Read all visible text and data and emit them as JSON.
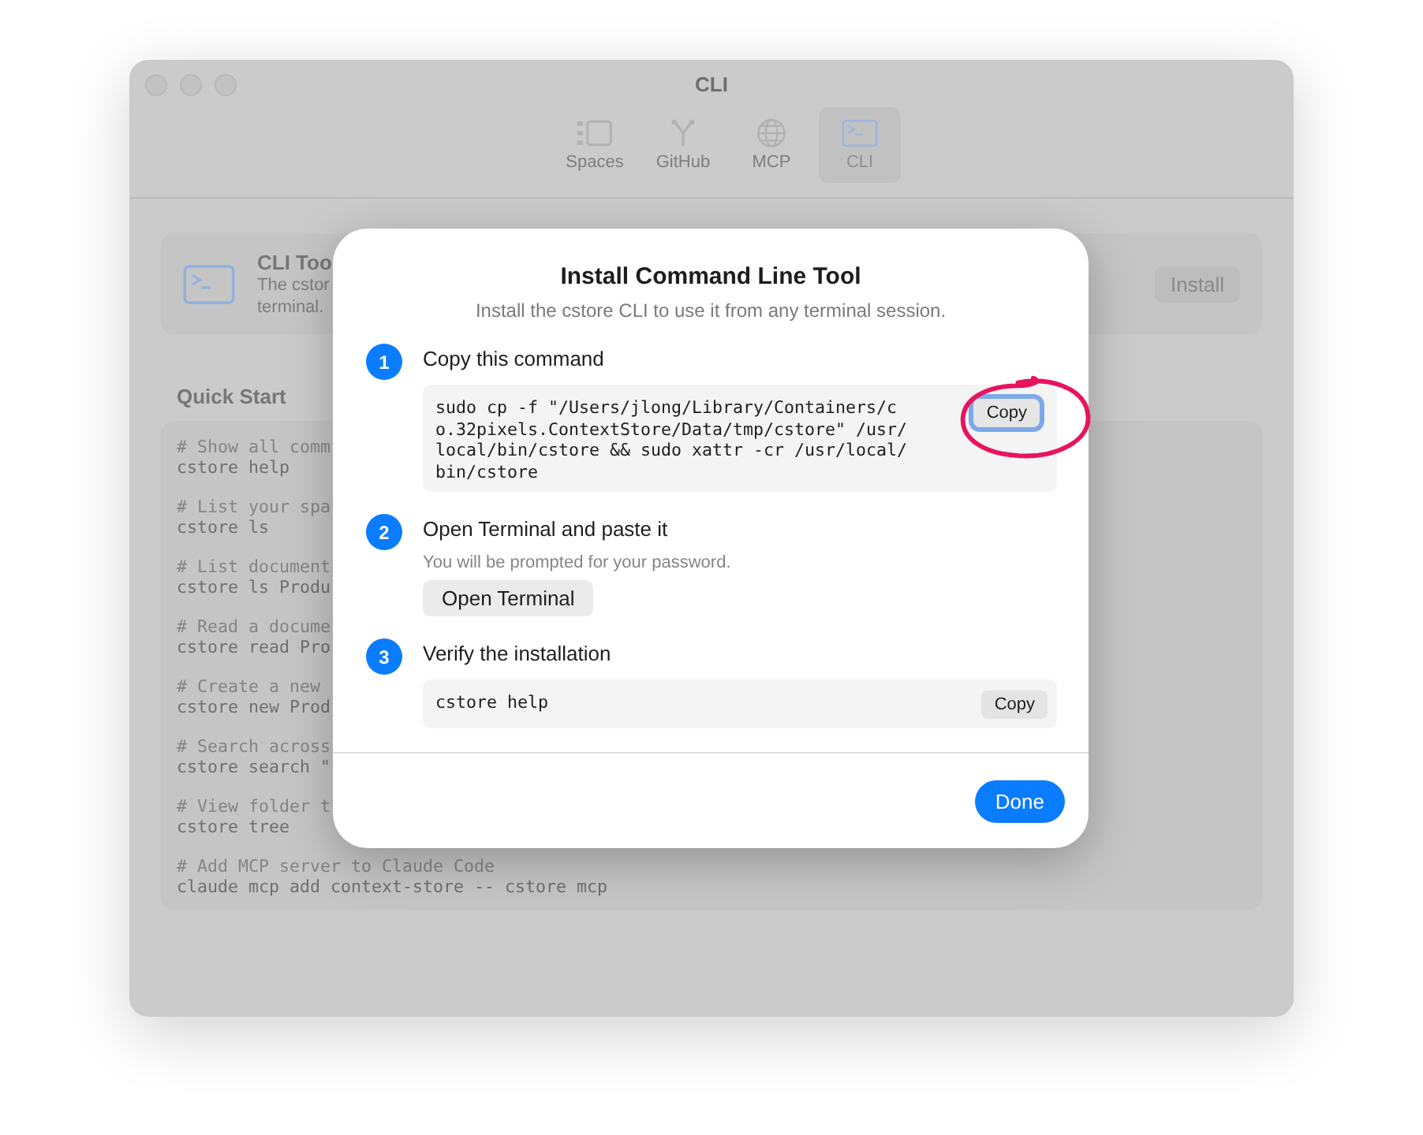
{
  "window": {
    "title": "CLI"
  },
  "tabs": [
    {
      "label": "Spaces",
      "selected": false
    },
    {
      "label": "GitHub",
      "selected": false
    },
    {
      "label": "MCP",
      "selected": false
    },
    {
      "label": "CLI",
      "selected": true
    }
  ],
  "cli_card": {
    "title": "CLI Too",
    "description": [
      "The cstor",
      "terminal."
    ],
    "button": "Install"
  },
  "quick_start": {
    "heading": "Quick Start",
    "lines": [
      {
        "kind": "comment",
        "text": "# Show all comm"
      },
      {
        "kind": "command",
        "text": "cstore help"
      },
      {
        "kind": "comment",
        "text": "# List your spa"
      },
      {
        "kind": "command",
        "text": "cstore ls"
      },
      {
        "kind": "comment",
        "text": "# List document"
      },
      {
        "kind": "command",
        "text": "cstore ls Produ"
      },
      {
        "kind": "comment",
        "text": "# Read a docume"
      },
      {
        "kind": "command",
        "text": "cstore read Pro"
      },
      {
        "kind": "comment",
        "text": "# Create a new"
      },
      {
        "kind": "command",
        "text": "cstore new Prod"
      },
      {
        "kind": "comment",
        "text": "# Search across"
      },
      {
        "kind": "command",
        "text": "cstore search \""
      },
      {
        "kind": "comment",
        "text": "# View folder t"
      },
      {
        "kind": "command",
        "text": "cstore tree"
      },
      {
        "kind": "comment",
        "text": "# Add MCP server to Claude Code"
      },
      {
        "kind": "command",
        "text": "claude mcp add context-store -- cstore mcp"
      }
    ]
  },
  "dialog": {
    "title": "Install Command Line Tool",
    "subtitle": "Install the cstore CLI to use it from any terminal session.",
    "steps": [
      {
        "number": "1",
        "title": "Copy this command",
        "code": "sudo cp -f \"/Users/jlong/Library/Containers/co.32pixels.ContextStore/Data/tmp/cstore\" /usr/local/bin/cstore && sudo xattr -cr /usr/local/bin/cstore",
        "copy_button": "Copy",
        "focused": true,
        "circled": true
      },
      {
        "number": "2",
        "title": "Open Terminal and paste it",
        "hint": "You will be prompted for your password.",
        "button": "Open Terminal"
      },
      {
        "number": "3",
        "title": "Verify the installation",
        "code": "cstore help",
        "copy_button": "Copy",
        "focused": false,
        "circled": false
      }
    ],
    "done_button": "Done"
  }
}
